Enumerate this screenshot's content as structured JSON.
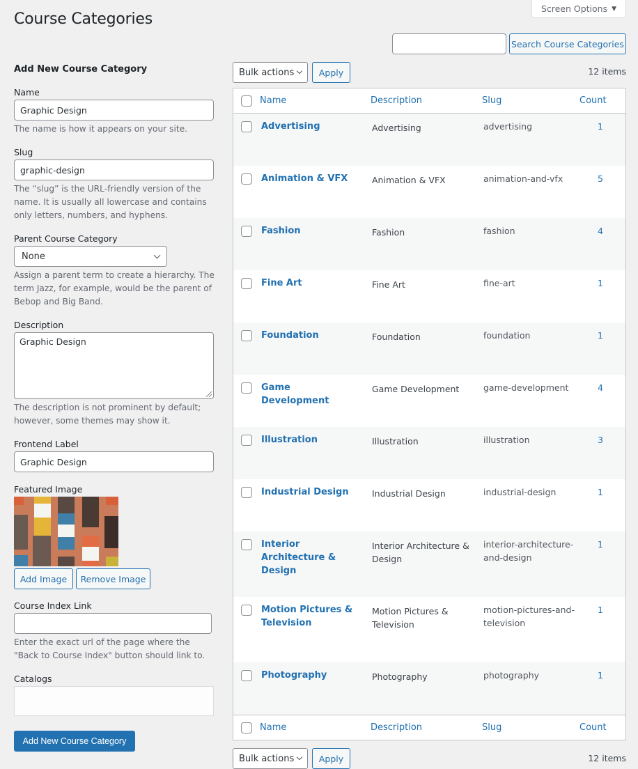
{
  "header": {
    "title": "Course Categories",
    "screen_options": "Screen Options",
    "search_placeholder": "",
    "search_value": "",
    "search_button": "Search Course Categories"
  },
  "form": {
    "heading": "Add New Course Category",
    "name_label": "Name",
    "name_value": "Graphic Design",
    "name_help": "The name is how it appears on your site.",
    "slug_label": "Slug",
    "slug_value": "graphic-design",
    "slug_help": "The “slug” is the URL-friendly version of the name. It is usually all lowercase and contains only letters, numbers, and hyphens.",
    "parent_label": "Parent Course Category",
    "parent_value": "None",
    "parent_help": "Assign a parent term to create a hierarchy. The term Jazz, for example, would be the parent of Bebop and Big Band.",
    "description_label": "Description",
    "description_value": "Graphic Design",
    "description_help": "The description is not prominent by default; however, some themes may show it.",
    "frontend_label": "Frontend Label",
    "frontend_value": "Graphic Design",
    "featured_image_label": "Featured Image",
    "add_image": "Add Image",
    "remove_image": "Remove Image",
    "index_link_label": "Course Index Link",
    "index_link_value": "",
    "index_link_help": "Enter the exact url of the page where the \"Back to Course Index\" button should link to.",
    "catalogs_label": "Catalogs",
    "submit": "Add New Course Category"
  },
  "tablenav": {
    "bulk_actions": "Bulk actions",
    "apply": "Apply",
    "items": "12 items"
  },
  "table": {
    "columns": [
      "Name",
      "Description",
      "Slug",
      "Count"
    ],
    "rows": [
      {
        "name": "Advertising",
        "description": "Advertising",
        "slug": "advertising",
        "count": "1"
      },
      {
        "name": "Animation & VFX",
        "description": "Animation & VFX",
        "slug": "animation-and-vfx",
        "count": "5"
      },
      {
        "name": "Fashion",
        "description": "Fashion",
        "slug": "fashion",
        "count": "4"
      },
      {
        "name": "Fine Art",
        "description": "Fine Art",
        "slug": "fine-art",
        "count": "1"
      },
      {
        "name": "Foundation",
        "description": "Foundation",
        "slug": "foundation",
        "count": "1"
      },
      {
        "name": "Game Development",
        "description": "Game Development",
        "slug": "game-development",
        "count": "4"
      },
      {
        "name": "Illustration",
        "description": "Illustration",
        "slug": "illustration",
        "count": "3"
      },
      {
        "name": "Industrial Design",
        "description": "Industrial Design",
        "slug": "industrial-design",
        "count": "1"
      },
      {
        "name": "Interior Architecture & Design",
        "description": "Interior Architecture & Design",
        "slug": "interior-architecture-and-design",
        "count": "1"
      },
      {
        "name": "Motion Pictures & Television",
        "description": "Motion Pictures & Television",
        "slug": "motion-pictures-and-television",
        "count": "1"
      },
      {
        "name": "Photography",
        "description": "Photography",
        "slug": "photography",
        "count": "1"
      }
    ]
  },
  "colors": {
    "accent": "#2271b1",
    "background": "#f0f0f1",
    "row_alt": "#f6f7f7"
  }
}
